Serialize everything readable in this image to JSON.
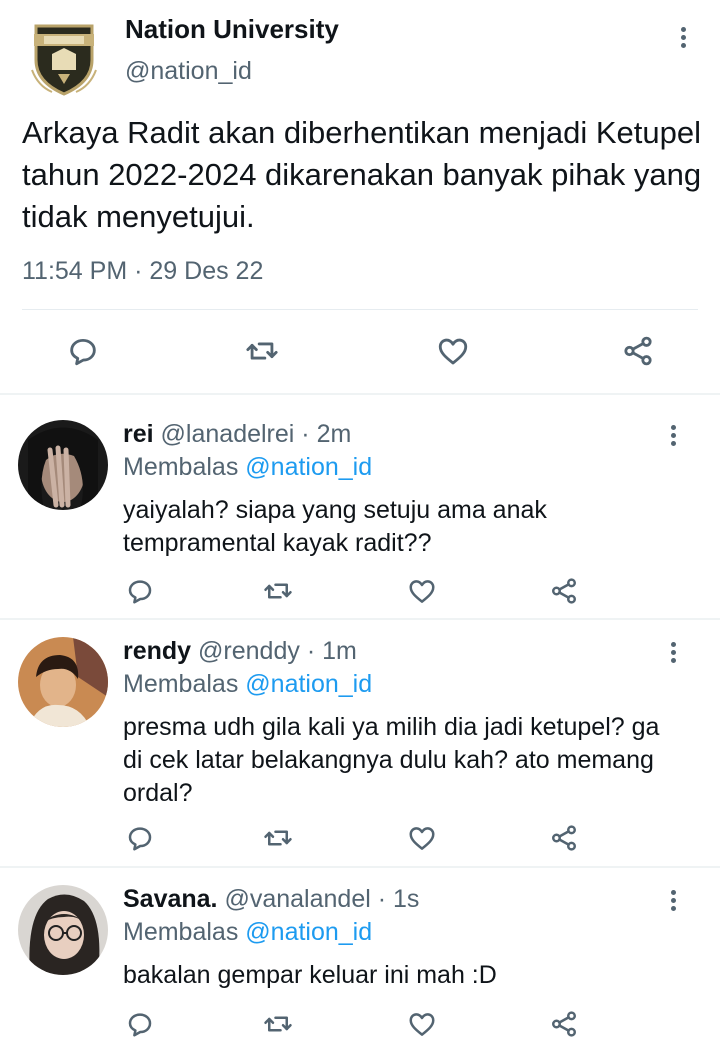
{
  "tweet": {
    "author_name": "Nation University",
    "author_handle": "@nation_id",
    "text": "Arkaya Radit akan diberhentikan menjadi Ketupel tahun 2022-2024 dikarenakan banyak pihak yang tidak menyetujui.",
    "time": "11:54 PM",
    "separator": "·",
    "date": "29 Des 22",
    "logo_icon": "university-crest-icon"
  },
  "replies": [
    {
      "name": "rei",
      "handle": "@lanadelrei",
      "time": "2m",
      "replying_label": "Membalas",
      "replying_to": "@nation_id",
      "text": "yaiyalah? siapa yang setuju ama anak tempramental kayak radit??"
    },
    {
      "name": "rendy",
      "handle": "@renddy",
      "time": "1m",
      "replying_label": "Membalas",
      "replying_to": "@nation_id",
      "text": "presma udh gila kali ya milih dia jadi ketupel? ga di cek latar belakangnya dulu kah? ato memang ordal?"
    },
    {
      "name": "Savana.",
      "handle": "@vanalandel",
      "time": "1s",
      "replying_label": "Membalas",
      "replying_to": "@nation_id",
      "text": "bakalan gempar keluar ini mah :D"
    }
  ],
  "colors": {
    "text": "#0f1419",
    "secondary": "#536471",
    "link": "#1d9bf0",
    "divider": "#eff3f4"
  },
  "icons": [
    "reply-icon",
    "retweet-icon",
    "like-icon",
    "share-icon",
    "more-options-icon"
  ]
}
